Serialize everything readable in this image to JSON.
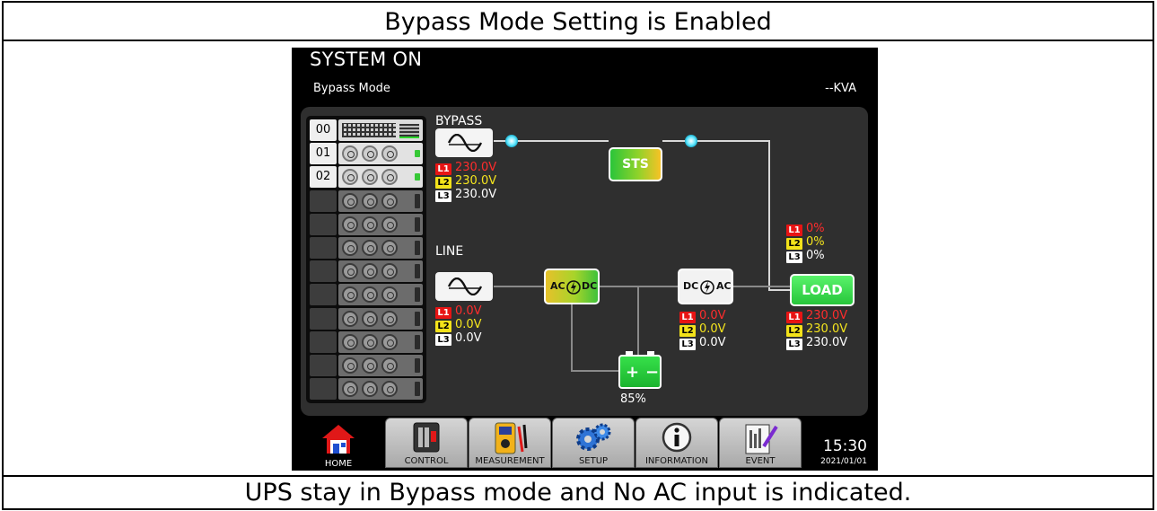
{
  "captions": {
    "top": "Bypass Mode Setting is Enabled",
    "bottom": "UPS stay in Bypass mode and No AC input is indicated."
  },
  "screen": {
    "title": "SYSTEM ON",
    "mode": "Bypass Mode",
    "kva": "--KVA"
  },
  "rack": {
    "modules": [
      {
        "num": "00",
        "kind": "stm"
      },
      {
        "num": "01",
        "kind": "active"
      },
      {
        "num": "02",
        "kind": "active"
      },
      {
        "num": "",
        "kind": "empty"
      },
      {
        "num": "",
        "kind": "empty"
      },
      {
        "num": "",
        "kind": "empty"
      },
      {
        "num": "",
        "kind": "empty"
      },
      {
        "num": "",
        "kind": "empty"
      },
      {
        "num": "",
        "kind": "empty"
      },
      {
        "num": "",
        "kind": "empty"
      },
      {
        "num": "",
        "kind": "empty"
      },
      {
        "num": "",
        "kind": "empty"
      }
    ]
  },
  "diagram": {
    "bypass_label": "BYPASS",
    "line_label": "LINE",
    "sts_label": "STS",
    "load_label": "LOAD",
    "ac_label": "AC",
    "dc_label": "DC",
    "battery_plus": "+",
    "battery_minus": "−",
    "battery_percent": "85%",
    "phase_tags": [
      "L1",
      "L2",
      "L3"
    ],
    "bypass_voltages": [
      "230.0V",
      "230.0V",
      "230.0V"
    ],
    "line_voltages": [
      "0.0V",
      "0.0V",
      "0.0V"
    ],
    "inverter_voltages": [
      "0.0V",
      "0.0V",
      "0.0V"
    ],
    "load_percent": [
      "0%",
      "0%",
      "0%"
    ],
    "load_voltages": [
      "230.0V",
      "230.0V",
      "230.0V"
    ]
  },
  "nav": {
    "home": "HOME",
    "control": "CONTROL",
    "measurement": "MEASUREMENT",
    "setup": "SETUP",
    "information": "INFORMATION",
    "event": "EVENT",
    "time": "15:30",
    "date": "2021/01/01"
  },
  "colors": {
    "phase1": "#e81414",
    "phase2": "#f3e21a",
    "phase3": "#ffffff",
    "active_green": "#27c63b",
    "node_cyan": "#66e9ff"
  }
}
